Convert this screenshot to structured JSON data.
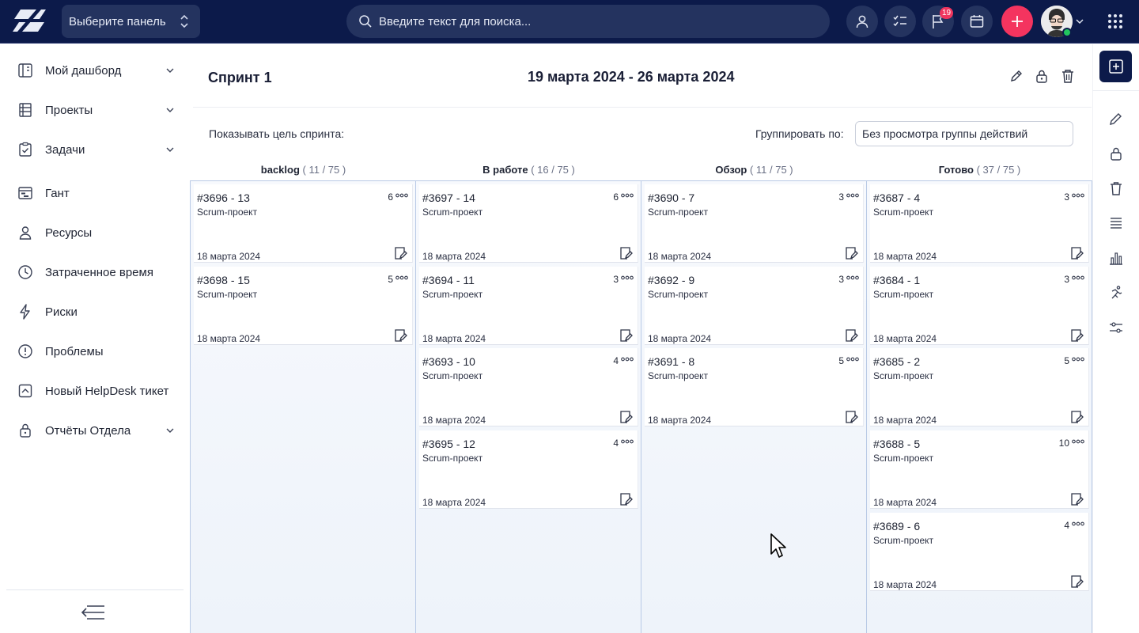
{
  "topbar": {
    "panel_select": "Выберите панель",
    "search_placeholder": "Введите текст для поиска...",
    "notifications_count": "19"
  },
  "sidebar": {
    "items": [
      {
        "label": "Мой дашборд",
        "icon": "dashboard-icon",
        "expandable": true
      },
      {
        "label": "Проекты",
        "icon": "projects-icon",
        "expandable": true
      },
      {
        "label": "Задачи",
        "icon": "tasks-icon",
        "expandable": true
      },
      {
        "label": "Гант",
        "icon": "gantt-icon",
        "expandable": false
      },
      {
        "label": "Ресурсы",
        "icon": "user-icon",
        "expandable": false
      },
      {
        "label": "Затраченное время",
        "icon": "clock-icon",
        "expandable": false
      },
      {
        "label": "Риски",
        "icon": "lightning-icon",
        "expandable": false
      },
      {
        "label": "Проблемы",
        "icon": "alert-icon",
        "expandable": false
      },
      {
        "label": "Новый HelpDesk тикет",
        "icon": "helpdesk-icon",
        "expandable": false
      },
      {
        "label": "Отчёты Отдела",
        "icon": "reports-icon",
        "expandable": true
      }
    ]
  },
  "sprint": {
    "title": "Спринт 1",
    "dates": "19 марта 2024 - 26 марта 2024",
    "show_goal_label": "Показывать цель спринта:",
    "group_by_label": "Группировать по:",
    "group_by_value": "Без просмотра группы действий"
  },
  "board": {
    "columns": [
      {
        "name": "backlog",
        "count": "( 11 / 75 )",
        "cards": [
          {
            "id": "#3696 - 13",
            "project": "Scrum-проект",
            "points": "6",
            "date": "18 марта 2024"
          },
          {
            "id": "#3698 - 15",
            "project": "Scrum-проект",
            "points": "5",
            "date": "18 марта 2024"
          }
        ]
      },
      {
        "name": "В работе",
        "count": "( 16 / 75 )",
        "cards": [
          {
            "id": "#3697 - 14",
            "project": "Scrum-проект",
            "points": "6",
            "date": "18 марта 2024"
          },
          {
            "id": "#3694 - 11",
            "project": "Scrum-проект",
            "points": "3",
            "date": "18 марта 2024"
          },
          {
            "id": "#3693 - 10",
            "project": "Scrum-проект",
            "points": "4",
            "date": "18 марта 2024"
          },
          {
            "id": "#3695 - 12",
            "project": "Scrum-проект",
            "points": "4",
            "date": "18 марта 2024"
          }
        ]
      },
      {
        "name": "Обзор",
        "count": "( 11 / 75 )",
        "cards": [
          {
            "id": "#3690 - 7",
            "project": "Scrum-проект",
            "points": "3",
            "date": "18 марта 2024"
          },
          {
            "id": "#3692 - 9",
            "project": "Scrum-проект",
            "points": "3",
            "date": "18 марта 2024"
          },
          {
            "id": "#3691 - 8",
            "project": "Scrum-проект",
            "points": "5",
            "date": "18 марта 2024"
          }
        ]
      },
      {
        "name": "Готово",
        "count": "( 37 / 75 )",
        "cards": [
          {
            "id": "#3687 - 4",
            "project": "Scrum-проект",
            "points": "3",
            "date": "18 марта 2024"
          },
          {
            "id": "#3684 - 1",
            "project": "Scrum-проект",
            "points": "3",
            "date": "18 марта 2024"
          },
          {
            "id": "#3685 - 2",
            "project": "Scrum-проект",
            "points": "5",
            "date": "18 марта 2024"
          },
          {
            "id": "#3688 - 5",
            "project": "Scrum-проект",
            "points": "10",
            "date": "18 марта 2024"
          },
          {
            "id": "#3689 - 6",
            "project": "Scrum-проект",
            "points": "4",
            "date": "18 марта 2024"
          }
        ]
      }
    ]
  },
  "colors": {
    "topbar": "#0c1a4a",
    "accent_red": "#f4345f",
    "column_border": "#b9cae6"
  }
}
